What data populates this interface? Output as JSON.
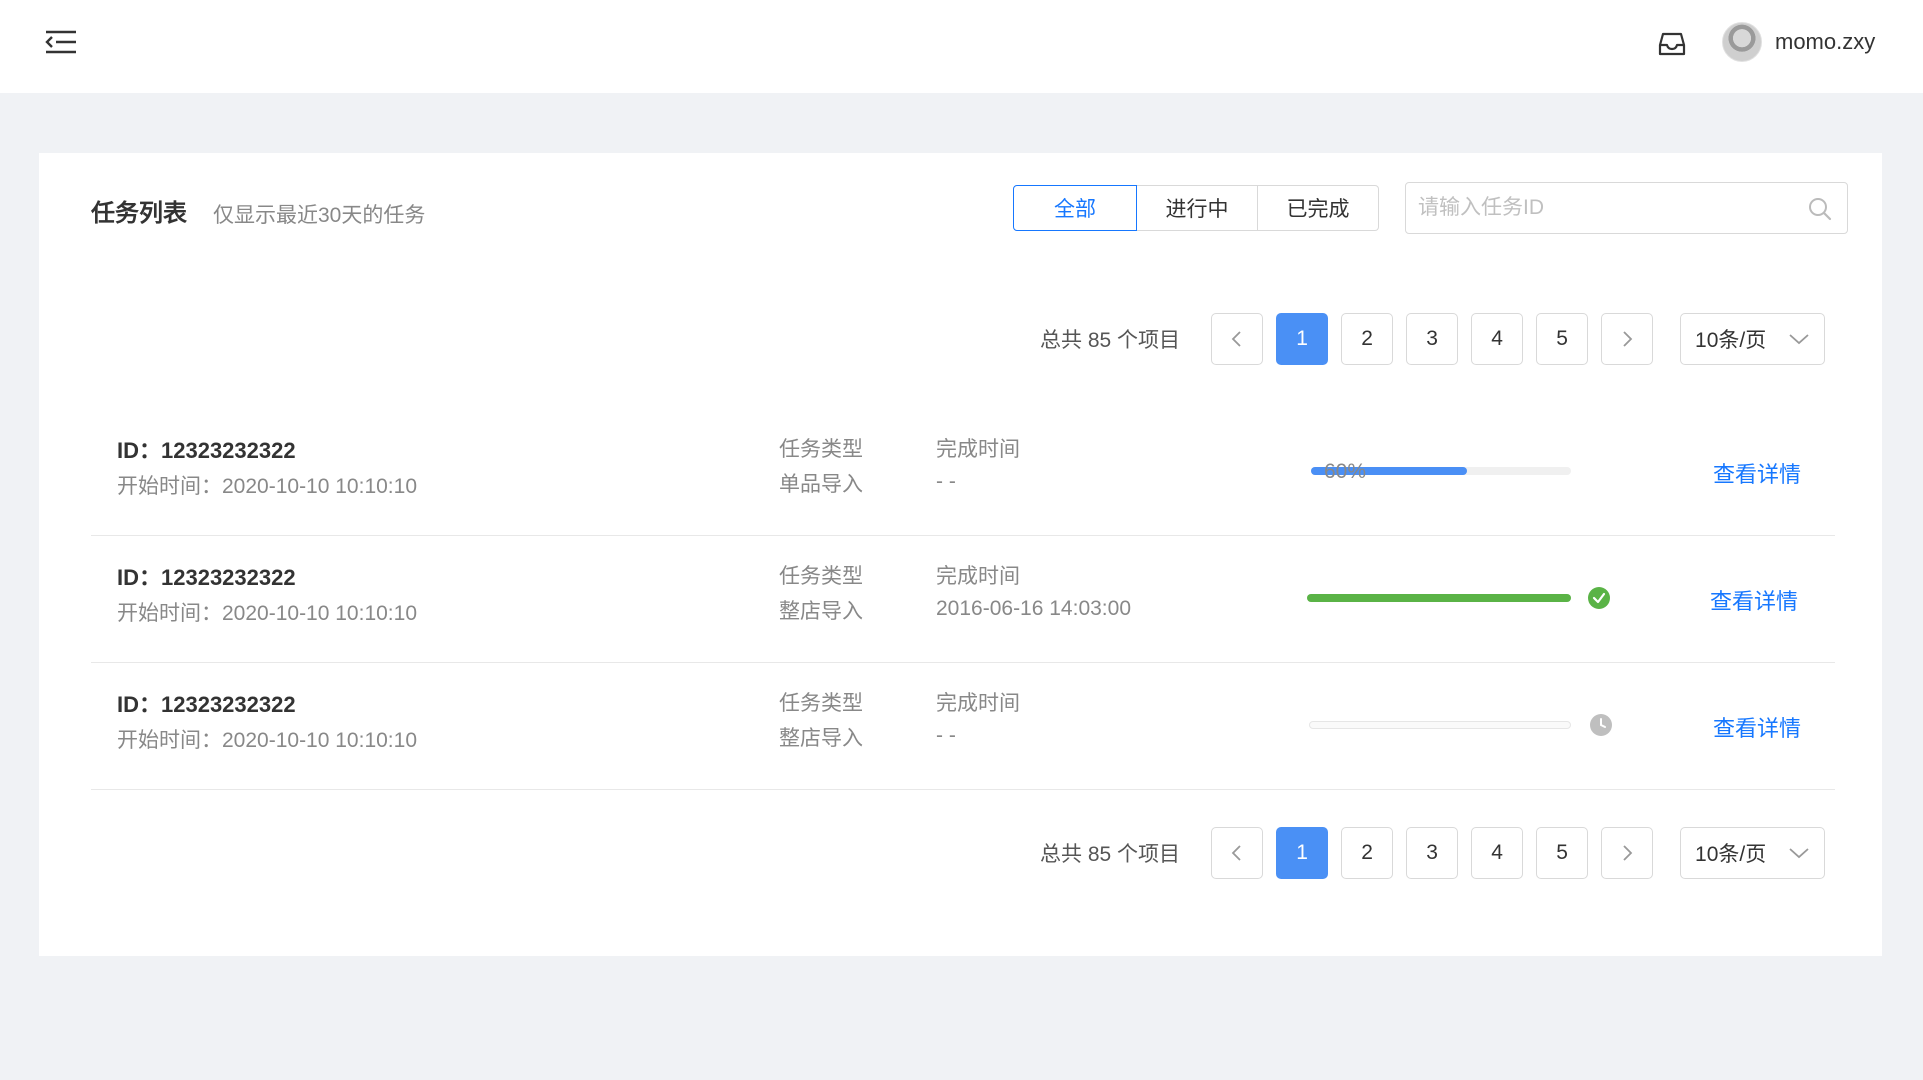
{
  "header": {
    "user": {
      "name": "momo.zxy"
    }
  },
  "card": {
    "title": "任务列表",
    "subtitle": "仅显示最近30天的任务",
    "filters": {
      "all": "全部",
      "running": "进行中",
      "done": "已完成",
      "selected": "全部"
    },
    "search": {
      "placeholder": "请输入任务ID"
    }
  },
  "pagination": {
    "total_text": "总共 85 个项目",
    "pages": [
      "1",
      "2",
      "3",
      "4",
      "5"
    ],
    "current": "1",
    "page_size": "10条/页"
  },
  "tasks": [
    {
      "id": "ID：12323232322",
      "start": "开始时间：2020-10-10 10:10:10",
      "type_label": "任务类型",
      "type_value": "单品导入",
      "done_label": "完成时间",
      "done_value": "- -",
      "progress": 0.6,
      "progress_text": "60%",
      "status": "running",
      "link": "查看详情"
    },
    {
      "id": "ID：12323232322",
      "start": "开始时间：2020-10-10 10:10:10",
      "type_label": "任务类型",
      "type_value": "整店导入",
      "done_label": "完成时间",
      "done_value": "2016-06-16  14:03:00",
      "progress": 1.0,
      "status": "success",
      "link": "查看详情"
    },
    {
      "id": "ID：12323232322",
      "start": "开始时间：2020-10-10 10:10:10",
      "type_label": "任务类型",
      "type_value": "整店导入",
      "done_label": "完成时间",
      "done_value": "- -",
      "progress": 0,
      "status": "pending",
      "link": "查看详情"
    }
  ],
  "colors": {
    "primary": "#1677ff",
    "progress_running": "#4a8ff5",
    "progress_success": "#5ab346",
    "pending_icon": "#bfbfbf"
  },
  "icons": {
    "menu": "menu-fold-icon",
    "inbox": "inbox-icon",
    "search": "search-icon",
    "prev": "chevron-left-icon",
    "next": "chevron-right-icon",
    "dropdown": "chevron-down-icon",
    "success": "check-circle-icon",
    "pending": "clock-icon"
  }
}
